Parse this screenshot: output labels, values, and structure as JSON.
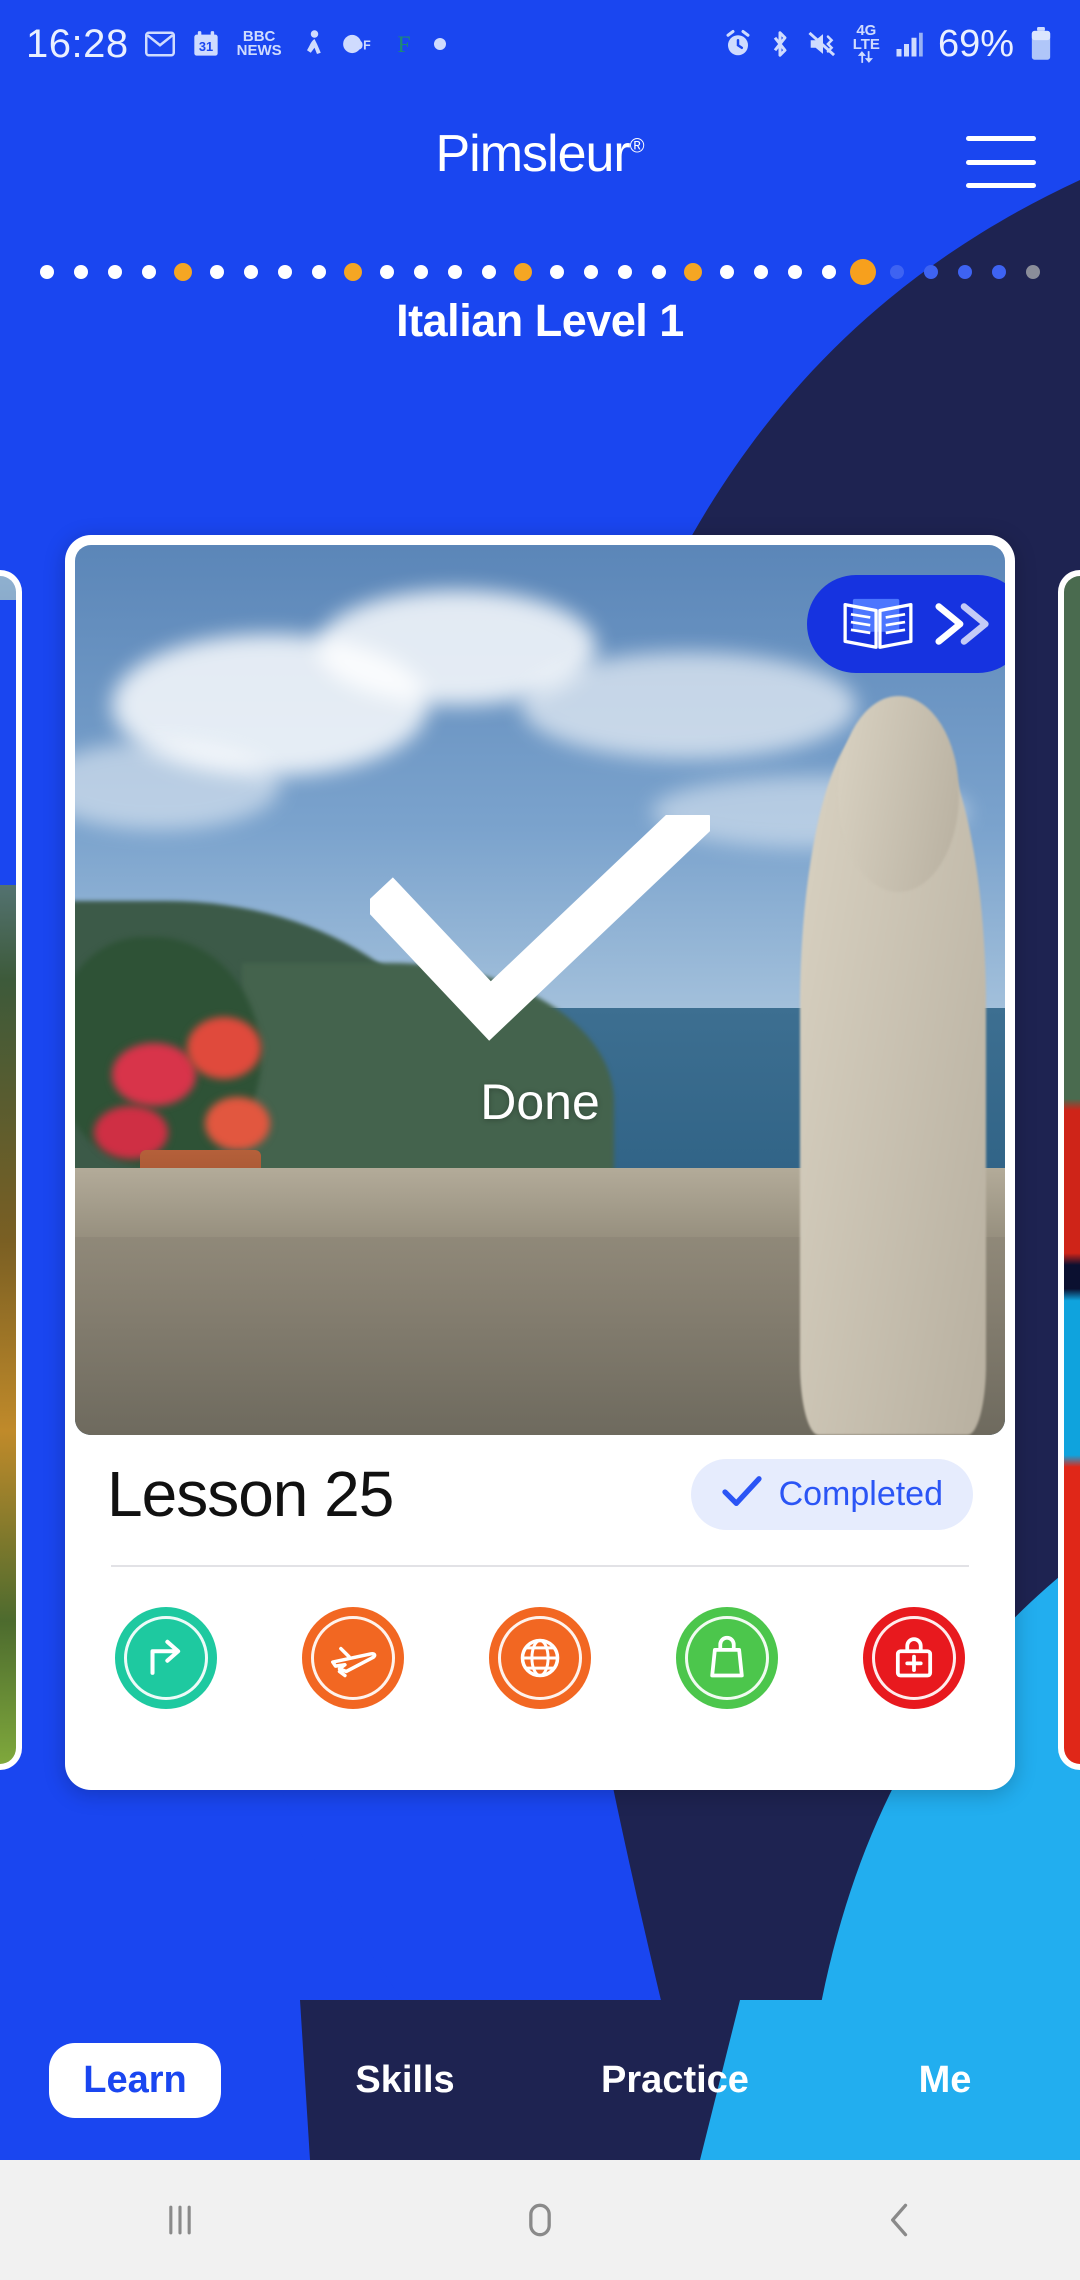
{
  "status_bar": {
    "clock": "16:28",
    "battery_percent": "69%",
    "network_line1": "4G",
    "network_line2": "LTE",
    "notification_icons": [
      "gmail-icon",
      "calendar-31-icon",
      "bbc-news-icon",
      "runtastic-icon",
      "zdf-icon",
      "flipboard-icon",
      "dot-notification-icon"
    ],
    "system_icons": [
      "alarm-icon",
      "bluetooth-icon",
      "mute-vibrate-icon",
      "mobile-data-icon",
      "signal-bars-icon",
      "battery-icon"
    ]
  },
  "header": {
    "brand": "Pimsleur",
    "brand_mark": "®",
    "menu_label": "menu"
  },
  "progress": {
    "level_title": "Italian Level 1",
    "total_dots": 30,
    "current_index": 24,
    "colors": {
      "completed": "#FFFFFF",
      "milestone": "#F5A623",
      "current": "#F7A01D",
      "upcoming": "#3E63F2",
      "locked": "#8A8D9A"
    }
  },
  "card": {
    "reading_button": {
      "book_icon": "open-book-icon",
      "chevrons": "»"
    },
    "overlay_status": "Done",
    "lesson_title": "Lesson 25",
    "badge": {
      "label": "Completed",
      "check": "✓"
    },
    "activities": [
      {
        "name": "quick-match-icon",
        "color": "#1EC9A0",
        "glyph": "arrow-turn-right-icon"
      },
      {
        "name": "flight-icon",
        "color": "#F26722",
        "glyph": "airplane-icon"
      },
      {
        "name": "culture-icon",
        "color": "#F26722",
        "glyph": "globe-icon"
      },
      {
        "name": "shopping-icon",
        "color": "#4CC64C",
        "glyph": "shopping-bag-icon"
      },
      {
        "name": "emergency-icon",
        "color": "#E8191E",
        "glyph": "first-aid-kit-icon"
      }
    ]
  },
  "peek_cards": {
    "left_chevron": "›",
    "right_chevron": "‹"
  },
  "tabs": [
    {
      "label": "Learn",
      "active": true,
      "bg": "#1A46F0"
    },
    {
      "label": "Skills",
      "active": false,
      "bg": "#1E2351"
    },
    {
      "label": "Practice",
      "active": false,
      "bg": "#1E2351"
    },
    {
      "label": "Me",
      "active": false,
      "bg": "#22AEEF"
    }
  ],
  "nav_bar": {
    "recents": "recents-icon",
    "home": "home-icon",
    "back": "back-icon"
  }
}
